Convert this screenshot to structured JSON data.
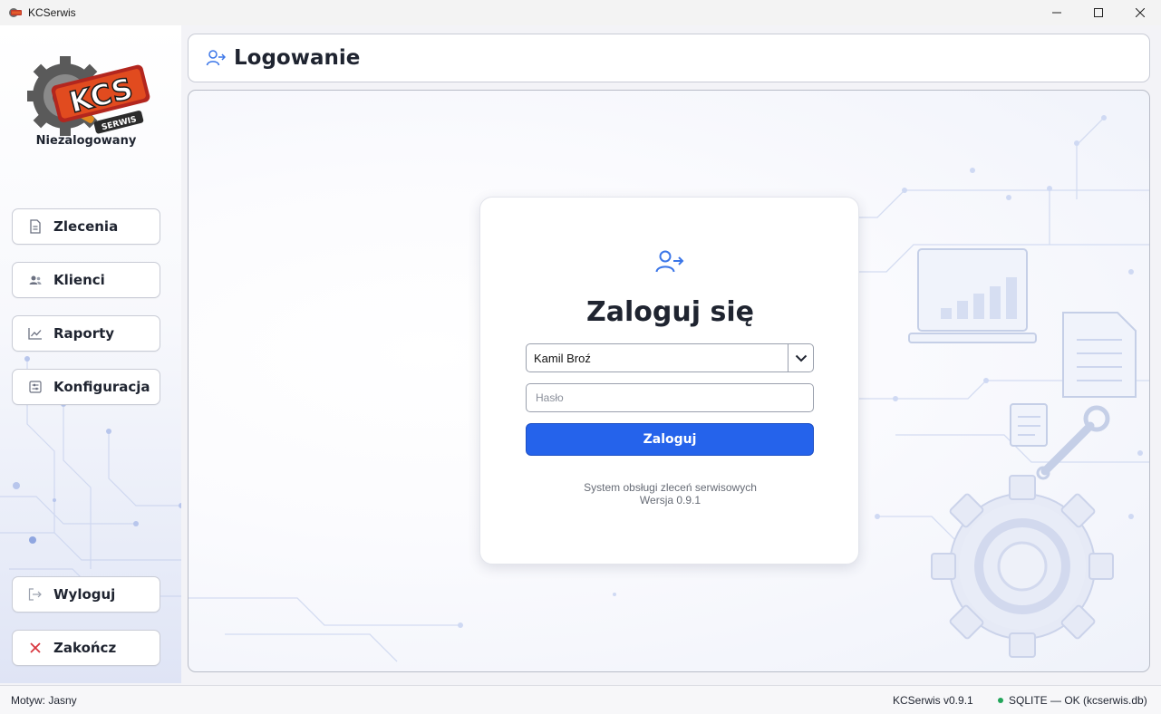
{
  "window": {
    "title": "KCSerwis"
  },
  "sidebar": {
    "logo_text": "KCS",
    "logo_subtext": "SERWIS",
    "user_status": "Niezalogowany",
    "nav": [
      {
        "label": "Zlecenia",
        "icon": "document-icon"
      },
      {
        "label": "Klienci",
        "icon": "users-icon"
      },
      {
        "label": "Raporty",
        "icon": "chart-line-icon"
      },
      {
        "label": "Konfiguracja",
        "icon": "sliders-icon"
      }
    ],
    "bottom": [
      {
        "label": "Wyloguj",
        "icon": "logout-icon"
      },
      {
        "label": "Zakończ",
        "icon": "close-x-icon",
        "color": "#d9363e"
      }
    ]
  },
  "header": {
    "title": "Logowanie",
    "icon": "user-login-icon"
  },
  "login": {
    "icon": "user-login-icon",
    "title": "Zaloguj się",
    "user_select_value": "Kamil Broź",
    "password_placeholder": "Hasło",
    "submit_label": "Zaloguj",
    "footer_line1": "System obsługi zleceń serwisowych",
    "footer_line2": "Wersja 0.9.1"
  },
  "statusbar": {
    "theme": "Motyw: Jasny",
    "version": "KCSerwis v0.9.1",
    "db_status": "SQLITE — OK (kcserwis.db)",
    "db_status_color": "#22a55a"
  },
  "colors": {
    "accent": "#2563eb",
    "danger": "#d9363e"
  }
}
